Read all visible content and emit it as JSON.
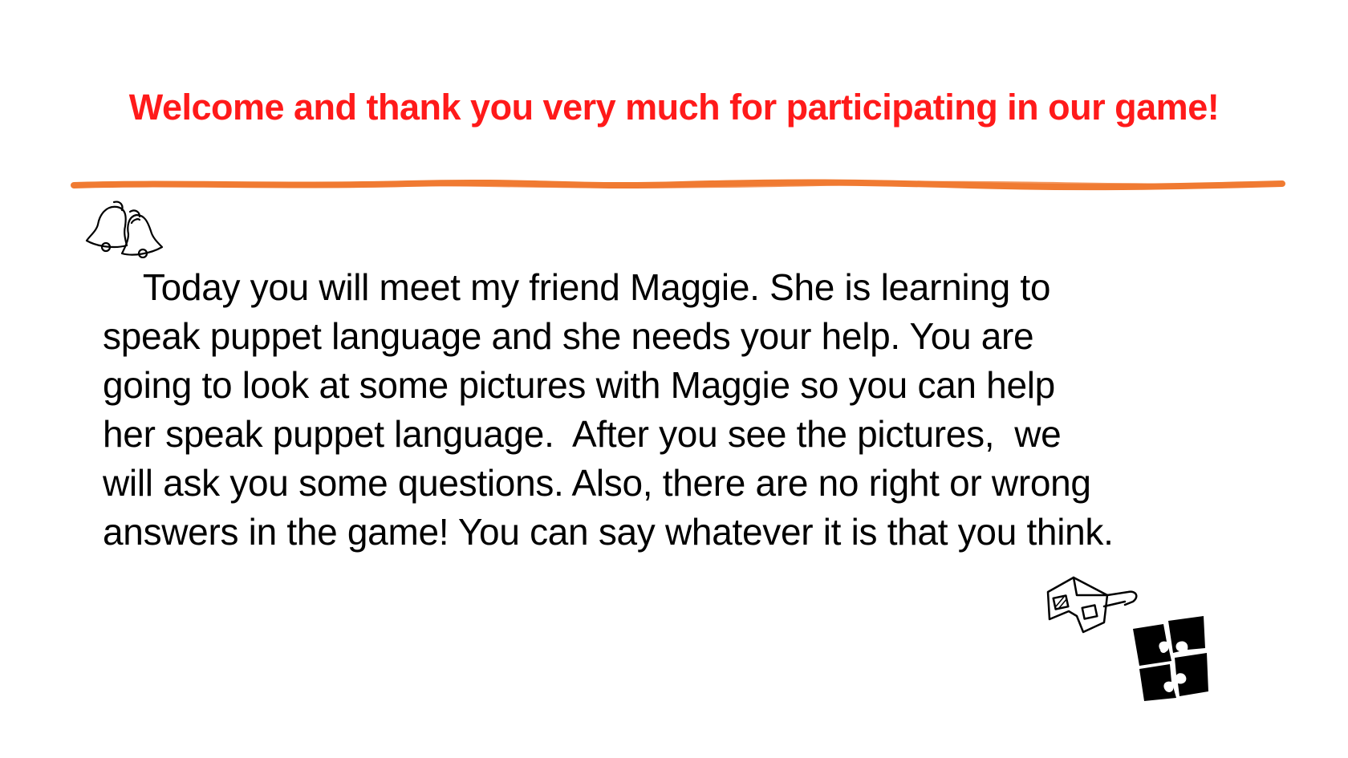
{
  "slide": {
    "title": "Welcome and thank you very much for participating in our game!",
    "body": "    Today you will meet my friend Maggie. She is learning to\nspeak puppet language and she needs your help. You are\ngoing to look at some pictures with Maggie so you can help\nher speak puppet language.  After you see the pictures,  we\nwill ask you some questions. Also, there are no right or wrong\nanswers in the game! You can say whatever it is that you think."
  },
  "colors": {
    "title": "#ff1a1a",
    "divider": "#f07b32",
    "text": "#000000"
  },
  "icons": [
    "bells-icon",
    "3d-glasses-icon",
    "puzzle-icon"
  ]
}
